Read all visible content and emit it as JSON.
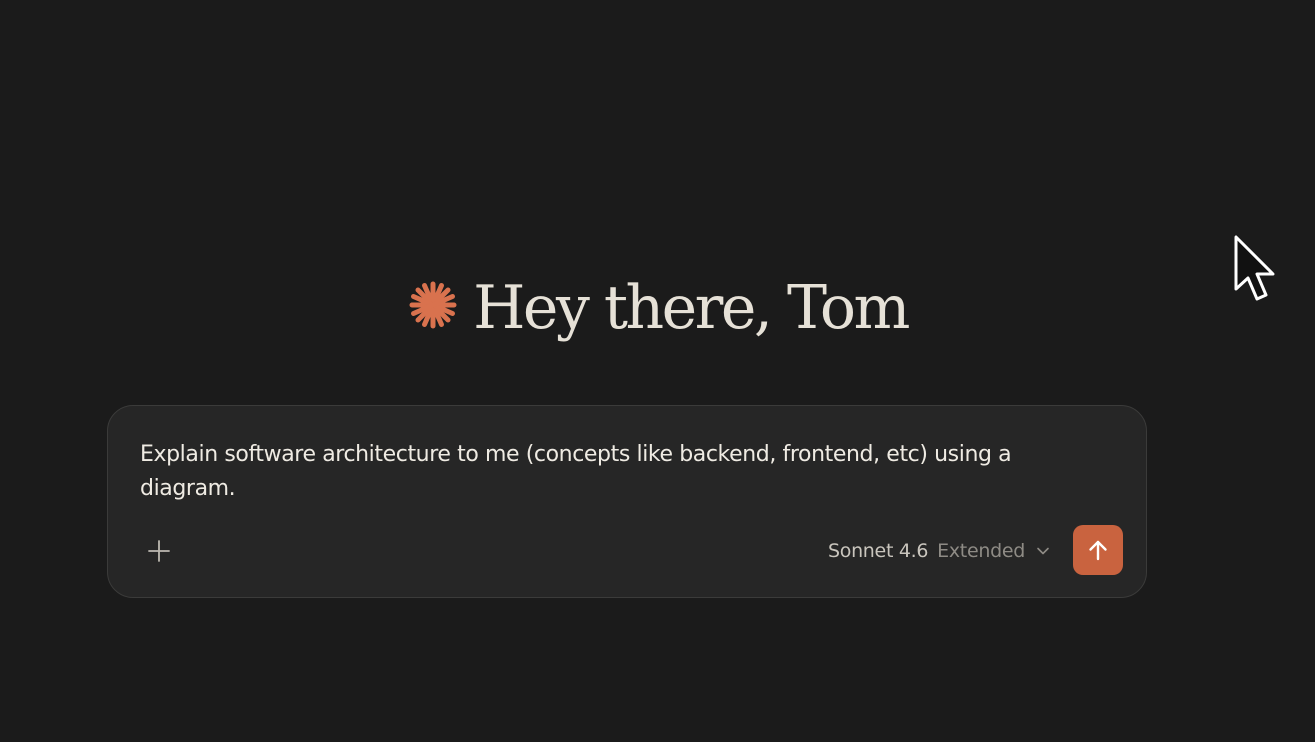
{
  "greeting": {
    "text": "Hey there, Tom",
    "icon": "sparkle-asterisk-icon",
    "icon_color": "#d9724e"
  },
  "composer": {
    "input_value": "Explain software architecture to me (concepts like backend, frontend, etc) using a diagram.",
    "add_icon": "plus-icon",
    "model": {
      "name": "Sonnet 4.6",
      "mode": "Extended",
      "chevron_icon": "chevron-down-icon"
    },
    "send_icon": "arrow-up-icon",
    "send_color": "#c9633f"
  },
  "colors": {
    "background": "#1b1b1b",
    "composer_background": "#262626",
    "composer_border": "#3b3b3a",
    "text": "#e8e4dc"
  },
  "cursor_icon": "mouse-pointer-icon"
}
